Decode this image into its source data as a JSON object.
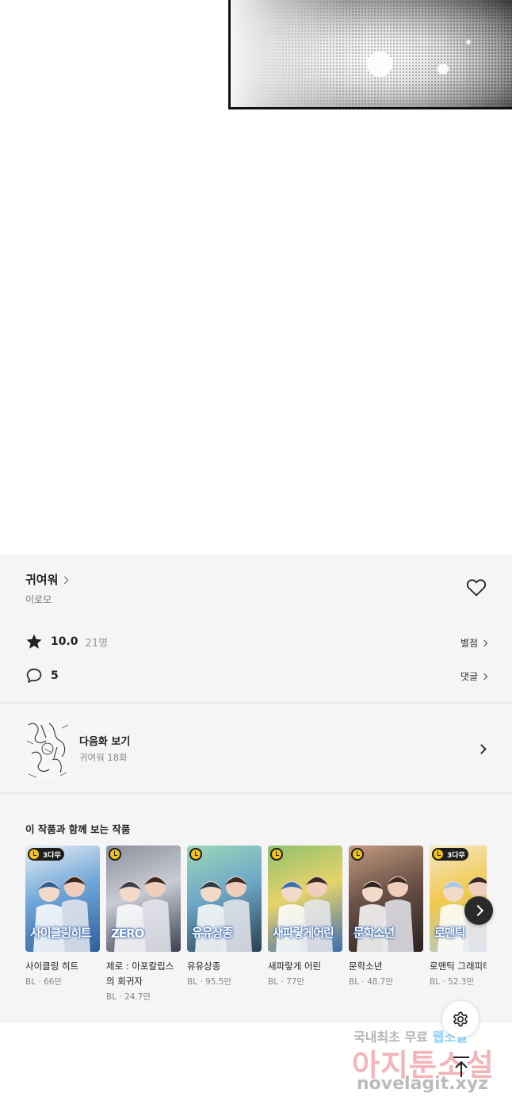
{
  "series": {
    "title": "귀여워",
    "author": "이로모",
    "favorite_icon": "heart-outline-icon"
  },
  "rating": {
    "icon": "star-icon",
    "score": "10.0",
    "count": "21명",
    "link_label": "별점"
  },
  "comments": {
    "icon": "speech-bubble-icon",
    "count": "5",
    "link_label": "댓글"
  },
  "next_episode": {
    "label": "다음화 보기",
    "subtitle": "귀여워 18화"
  },
  "recommendations": {
    "heading": "이 작품과 함께 보는 작품",
    "items": [
      {
        "name": "사이클링 히트",
        "meta": "BL · 66만",
        "badge": "3다무",
        "has_badge_text": true,
        "cover_text": "사이클링히트",
        "palette": [
          "#6fa6d8",
          "#2d5f9a",
          "#e9eef5"
        ]
      },
      {
        "name": "제로 : 아포칼립스의 회귀자",
        "meta": "BL · 24.7만",
        "badge": "",
        "has_badge_text": false,
        "cover_text": "ZERO",
        "palette": [
          "#c9ccd4",
          "#3b4050",
          "#8b8f9a"
        ]
      },
      {
        "name": "유유상종",
        "meta": "BL · 95.5만",
        "badge": "",
        "has_badge_text": false,
        "cover_text": "유유상종",
        "palette": [
          "#6ea8c8",
          "#2a3f4e",
          "#9dd6b8"
        ]
      },
      {
        "name": "새파랗게 어린",
        "meta": "BL · 77만",
        "badge": "",
        "has_badge_text": false,
        "cover_text": "새파랗게어린",
        "palette": [
          "#e7d36a",
          "#3c6fb0",
          "#8fc16e"
        ]
      },
      {
        "name": "문학소년",
        "meta": "BL · 48.7만",
        "badge": "",
        "has_badge_text": false,
        "cover_text": "문학소년",
        "palette": [
          "#6b5247",
          "#2b2220",
          "#c39a80"
        ]
      },
      {
        "name": "로맨틱 그래피티",
        "meta": "BL · 52.3만",
        "badge": "3다무",
        "has_badge_text": true,
        "cover_text": "로맨틱",
        "palette": [
          "#f0c94a",
          "#a6c9e6",
          "#f4e8c8"
        ]
      }
    ],
    "scroll_icon": "chevron-right-icon"
  },
  "floating": {
    "settings_icon": "gear-icon",
    "top_icon": "arrow-up-icon"
  },
  "watermark": {
    "line1_a": "국내최초 무료 ",
    "line1_b": "웹소설",
    "line2": "아지툰소설",
    "line3": "novelagit.xyz"
  }
}
